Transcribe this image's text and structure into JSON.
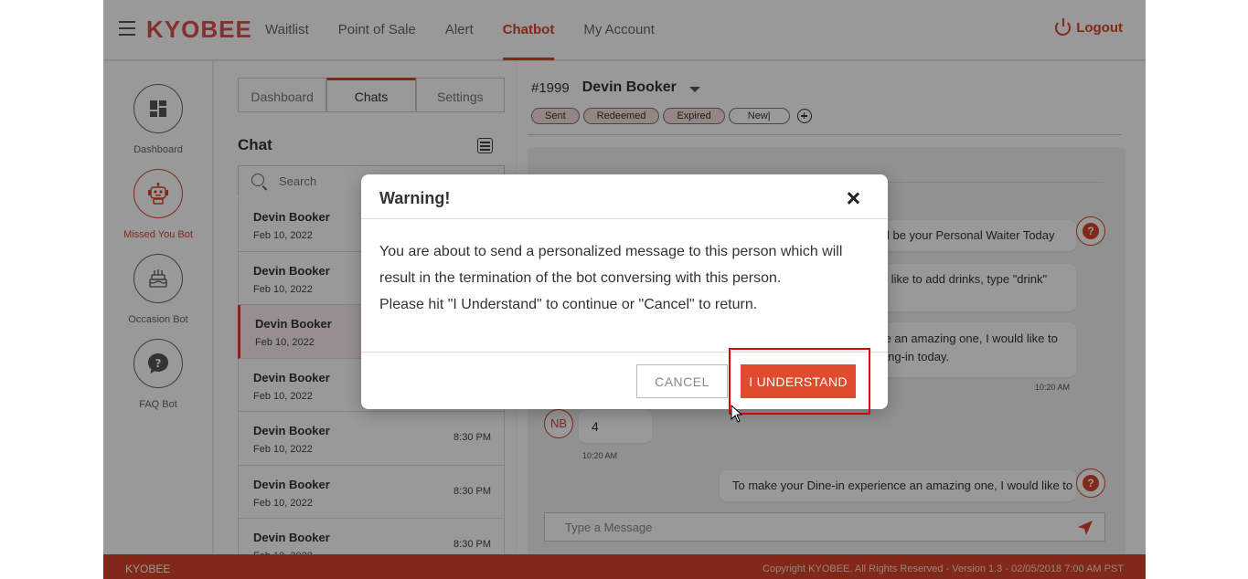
{
  "header": {
    "logo": "KYOBEE",
    "nav": [
      "Waitlist",
      "Point of Sale",
      "Alert",
      "Chatbot",
      "My Account"
    ],
    "active_nav": "Chatbot",
    "logout": "Logout"
  },
  "rail": [
    {
      "label": "Dashboard",
      "icon": "dashboard-icon"
    },
    {
      "label": "Missed You Bot",
      "icon": "robot-icon",
      "active": true
    },
    {
      "label": "Occasion Bot",
      "icon": "cake-icon"
    },
    {
      "label": "FAQ Bot",
      "icon": "faq-icon"
    }
  ],
  "list": {
    "tabs": [
      "Dashboard",
      "Chats",
      "Settings"
    ],
    "active_tab": "Chats",
    "title": "Chat",
    "search_placeholder": "Search",
    "items": [
      {
        "name": "Devin Booker",
        "date": "Feb 10, 2022",
        "time": ""
      },
      {
        "name": "Devin Booker",
        "date": "Feb 10, 2022",
        "time": ""
      },
      {
        "name": "Devin Booker",
        "date": "Feb 10, 2022",
        "time": "",
        "selected": true
      },
      {
        "name": "Devin Booker",
        "date": "Feb 10, 2022",
        "time": ""
      },
      {
        "name": "Devin Booker",
        "date": "Feb 10, 2022",
        "time": "8:30 PM"
      },
      {
        "name": "Devin Booker",
        "date": "Feb 10, 2022",
        "time": "8:30 PM"
      },
      {
        "name": "Devin Booker",
        "date": "Feb 10, 2022",
        "time": "8:30 PM"
      }
    ]
  },
  "convo": {
    "id": "#1999",
    "name": "Devin Booker",
    "chips": [
      "Sent",
      "Redeemed",
      "Expired",
      "New|"
    ],
    "messages": {
      "m1": "I'll be your Personal Waiter Today",
      "m2": "ld like to add drinks, type \"drink\"",
      "m3a": "ce an amazing one, I would like to",
      "m3b": "ning-in today.",
      "t1": "10:20 AM",
      "reply": "4",
      "avatar": "NB",
      "t2": "10:20 AM",
      "m4": "To make your Dine-in experience an amazing one, I would like to"
    },
    "input_placeholder": "Type a Message"
  },
  "footer": {
    "left": "KYOBEE",
    "right": "Copyright KYOBEE. All Rights Reserved - Version 1.3 - 02/05/2018 7:00 AM PST"
  },
  "modal": {
    "title": "Warning!",
    "line1": "You are about to send a personalized message to this person which will",
    "line2": "result in the termination of the bot conversing with this person.",
    "line3": "Please hit \"I Understand\" to continue or \"Cancel\" to return.",
    "cancel": "CANCEL",
    "confirm": "I UNDERSTAND"
  },
  "colors": {
    "accent": "#d9442b",
    "highlight": "#e00000"
  }
}
